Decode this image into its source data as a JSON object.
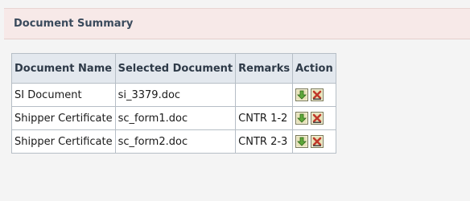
{
  "panel": {
    "title": "Document Summary"
  },
  "table": {
    "columns": [
      "Document Name",
      "Selected Document",
      "Remarks",
      "Action"
    ],
    "rows": [
      {
        "document_name": "SI Document",
        "selected_document": "si_3379.doc",
        "remarks": ""
      },
      {
        "document_name": "Shipper Certificate",
        "selected_document": "sc_form1.doc",
        "remarks": "CNTR 1-2"
      },
      {
        "document_name": "Shipper Certificate",
        "selected_document": "sc_form2.doc",
        "remarks": "CNTR 2-3"
      }
    ],
    "actions": [
      "download-icon",
      "delete-icon"
    ]
  },
  "colors": {
    "header_band": "#f7e9e8",
    "table_header": "#e3e8ee",
    "download_icon": "#5fa83a",
    "delete_icon": "#c0392b"
  }
}
